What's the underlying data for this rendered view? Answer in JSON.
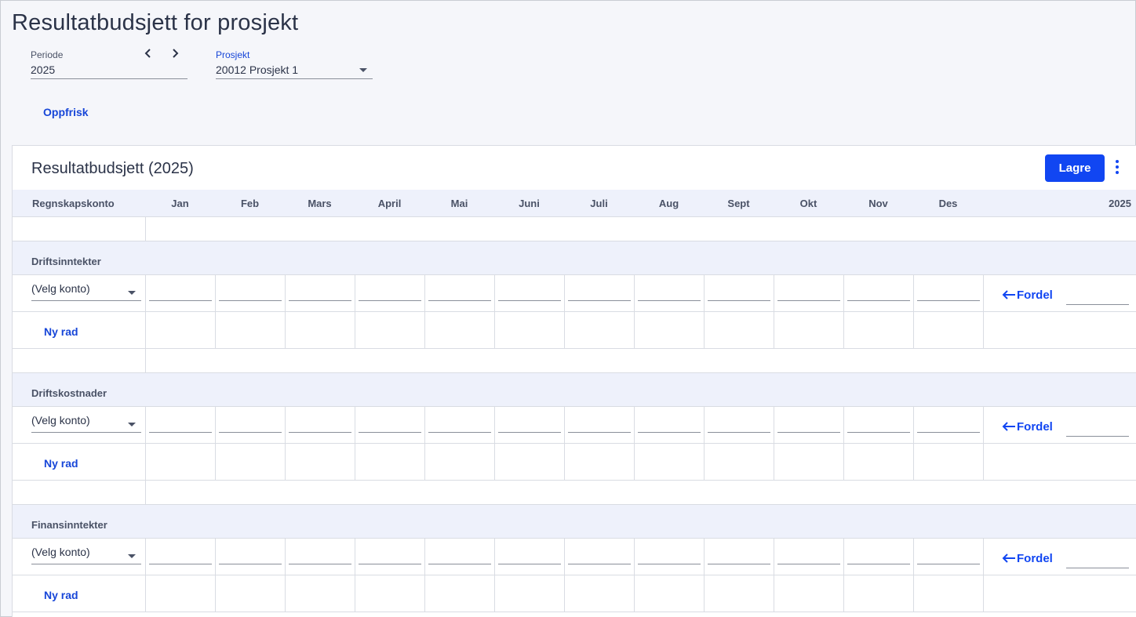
{
  "page": {
    "title": "Resultatbudsjett for prosjekt"
  },
  "filters": {
    "periode_label": "Periode",
    "periode_value": "2025",
    "prosjekt_label": "Prosjekt",
    "prosjekt_value": "20012 Prosjekt 1"
  },
  "actions": {
    "refresh_label": "Oppfrisk"
  },
  "card": {
    "title": "Resultatbudsjett (2025)",
    "save_label": "Lagre"
  },
  "table": {
    "account_header": "Regnskapskonto",
    "months": [
      "Jan",
      "Feb",
      "Mars",
      "April",
      "Mai",
      "Juni",
      "Juli",
      "Aug",
      "Sept",
      "Okt",
      "Nov",
      "Des"
    ],
    "total_header": "2025",
    "sections": [
      {
        "label": "Driftsinntekter",
        "select_placeholder": "(Velg konto)",
        "distribute_label": "Fordel",
        "new_row_label": "Ny rad"
      },
      {
        "label": "Driftskostnader",
        "select_placeholder": "(Velg konto)",
        "distribute_label": "Fordel",
        "new_row_label": "Ny rad"
      },
      {
        "label": "Finansinntekter",
        "select_placeholder": "(Velg konto)",
        "distribute_label": "Fordel",
        "new_row_label": "Ny rad"
      }
    ]
  },
  "colors": {
    "accent": "#1146f2",
    "header_bg": "#eef1fb",
    "page_bg": "#f5f6fa"
  }
}
